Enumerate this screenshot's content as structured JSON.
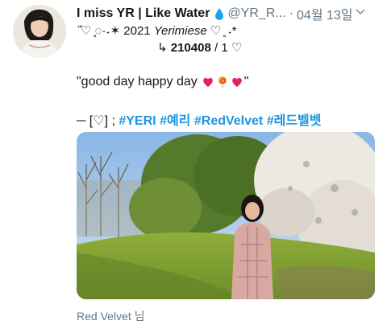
{
  "tweet": {
    "display_name": "I miss YR | Like Water",
    "handle": "@YR_R...",
    "separator": "·",
    "date": "04월 13일",
    "bio_line1_prefix": "ʾ̊♡ ̥◌·˖✶",
    "bio_line1_year": "2021",
    "bio_line1_name": "Yerimiese",
    "bio_line1_suffix": "♡ ̥ ˖*",
    "bio_line2_arrow": "↳",
    "bio_line2_count": "210408",
    "bio_line2_rest": "/ 1 ♡",
    "quote_open": "\"good day happy day",
    "quote_close": "\"",
    "tags_prefix": "─ [♡] ;",
    "hashtags": [
      "#YERI",
      "#예리",
      "#RedVelvet",
      "#레드벨벳"
    ],
    "footer": "Red Velvet 님"
  },
  "icons": {
    "drop": "water-drop-icon",
    "caret": "chevron-down-icon",
    "emoji": [
      "heart-emoji-icon",
      "lollipop-emoji-icon",
      "heart-emoji-icon"
    ]
  },
  "colors": {
    "link": "#1b95e0",
    "muted": "#657786",
    "drop": "#1da1f2",
    "heart": "#e0245e"
  }
}
